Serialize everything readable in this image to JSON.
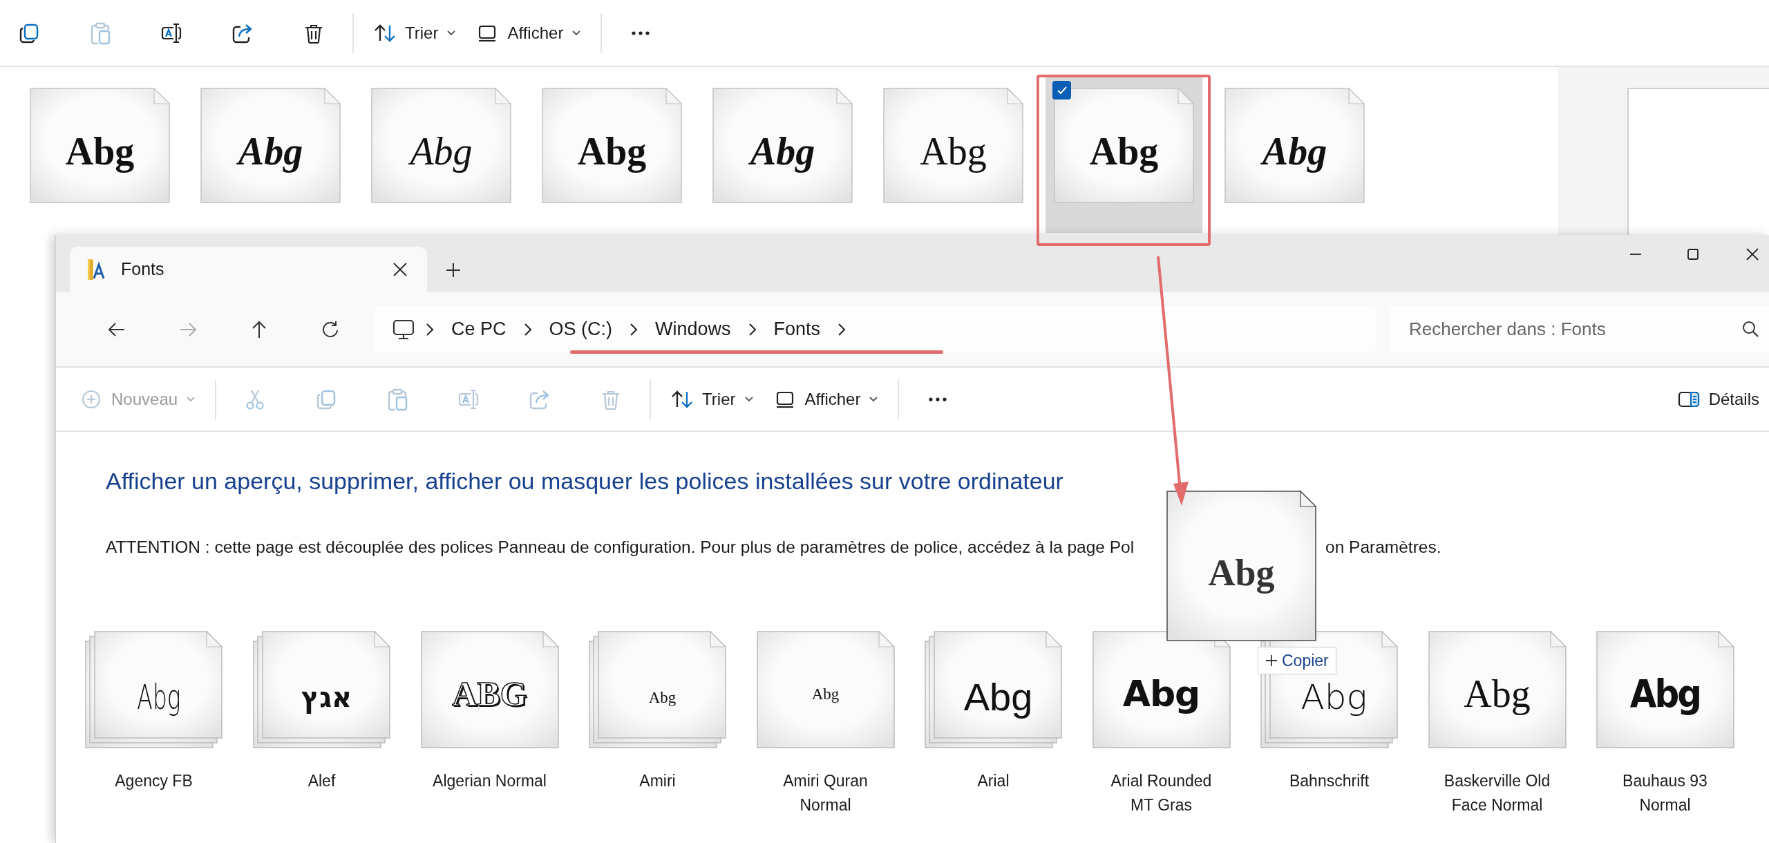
{
  "background_window": {
    "toolbar": {
      "groups": [
        [
          {
            "kind": "copy",
            "disabled": false
          },
          {
            "kind": "paste",
            "disabled": true
          },
          {
            "kind": "rename",
            "disabled": false
          },
          {
            "kind": "share",
            "disabled": false
          },
          {
            "kind": "delete",
            "disabled": false
          }
        ],
        [
          {
            "kind": "sort",
            "label": "Trier",
            "disabled": false
          },
          {
            "kind": "view",
            "label": "Afficher",
            "disabled": false
          }
        ],
        [
          {
            "kind": "more",
            "disabled": false
          }
        ]
      ]
    },
    "files": [
      {
        "sample": "Abg",
        "kind": "bold",
        "selected": false
      },
      {
        "sample": "Abg",
        "kind": "bold-italic",
        "selected": false
      },
      {
        "sample": "Abg",
        "kind": "italic",
        "selected": false
      },
      {
        "sample": "Abg",
        "kind": "medium",
        "selected": false
      },
      {
        "sample": "Abg",
        "kind": "medium-italic",
        "selected": false
      },
      {
        "sample": "Abg",
        "kind": "regular",
        "selected": false
      },
      {
        "sample": "Abg",
        "kind": "semibold",
        "selected": true
      },
      {
        "sample": "Abg",
        "kind": "semibold-italic",
        "selected": false
      }
    ]
  },
  "window": {
    "tab": {
      "title": "Fonts"
    },
    "address": {
      "crumbs": [
        "Ce PC",
        "OS (C:)",
        "Windows",
        "Fonts"
      ]
    },
    "search": {
      "placeholder": "Rechercher dans : Fonts"
    },
    "toolbar": {
      "groups": [
        [
          {
            "kind": "new",
            "label": "Nouveau",
            "disabled": true
          }
        ],
        [
          {
            "kind": "cut",
            "disabled": true
          },
          {
            "kind": "copy",
            "disabled": true
          },
          {
            "kind": "paste",
            "disabled": true
          },
          {
            "kind": "rename",
            "disabled": true
          },
          {
            "kind": "share",
            "disabled": true
          },
          {
            "kind": "delete",
            "disabled": true
          }
        ],
        [
          {
            "kind": "sort",
            "label": "Trier",
            "disabled": false
          },
          {
            "kind": "view",
            "label": "Afficher",
            "disabled": false
          }
        ],
        [
          {
            "kind": "more",
            "disabled": false
          }
        ]
      ],
      "right": {
        "kind": "details",
        "label": "Détails",
        "disabled": false
      }
    },
    "heading": "Afficher un aperçu, supprimer, afficher ou masquer les polices installées sur votre ordinateur",
    "notice": {
      "before": "ATTENTION : cette page est découplée des polices Panneau de configuration. Pour plus de paramètres de police, accédez à la page Pol",
      "after": "on Paramètres."
    },
    "fonts": [
      {
        "name": "Agency FB",
        "sample": "Abg",
        "kind": "condensed",
        "stacked": true
      },
      {
        "name": "Alef",
        "sample": "אגץ",
        "kind": "hebrew",
        "stacked": true
      },
      {
        "name": "Algerian Normal",
        "sample": "ABG",
        "kind": "decorative",
        "stacked": false
      },
      {
        "name": "Amiri",
        "sample": "Abg",
        "kind": "serif-small",
        "stacked": true
      },
      {
        "name": "Amiri Quran Normal",
        "sample": "Abg",
        "kind": "serif-small",
        "stacked": false
      },
      {
        "name": "Arial",
        "sample": "Abg",
        "kind": "sans",
        "stacked": true
      },
      {
        "name": "Arial Rounded MT Gras",
        "sample": "Abg",
        "kind": "sans-heavy",
        "stacked": false
      },
      {
        "name": "Bahnschrift",
        "sample": "Abg",
        "kind": "sans-light",
        "stacked": true
      },
      {
        "name": "Baskerville Old Face Normal",
        "sample": "Abg",
        "kind": "serif",
        "stacked": false
      },
      {
        "name": "Bauhaus 93 Normal",
        "sample": "Abg",
        "kind": "display",
        "stacked": false
      }
    ]
  },
  "drag": {
    "sample": "Abg",
    "tooltip": "Copier"
  }
}
